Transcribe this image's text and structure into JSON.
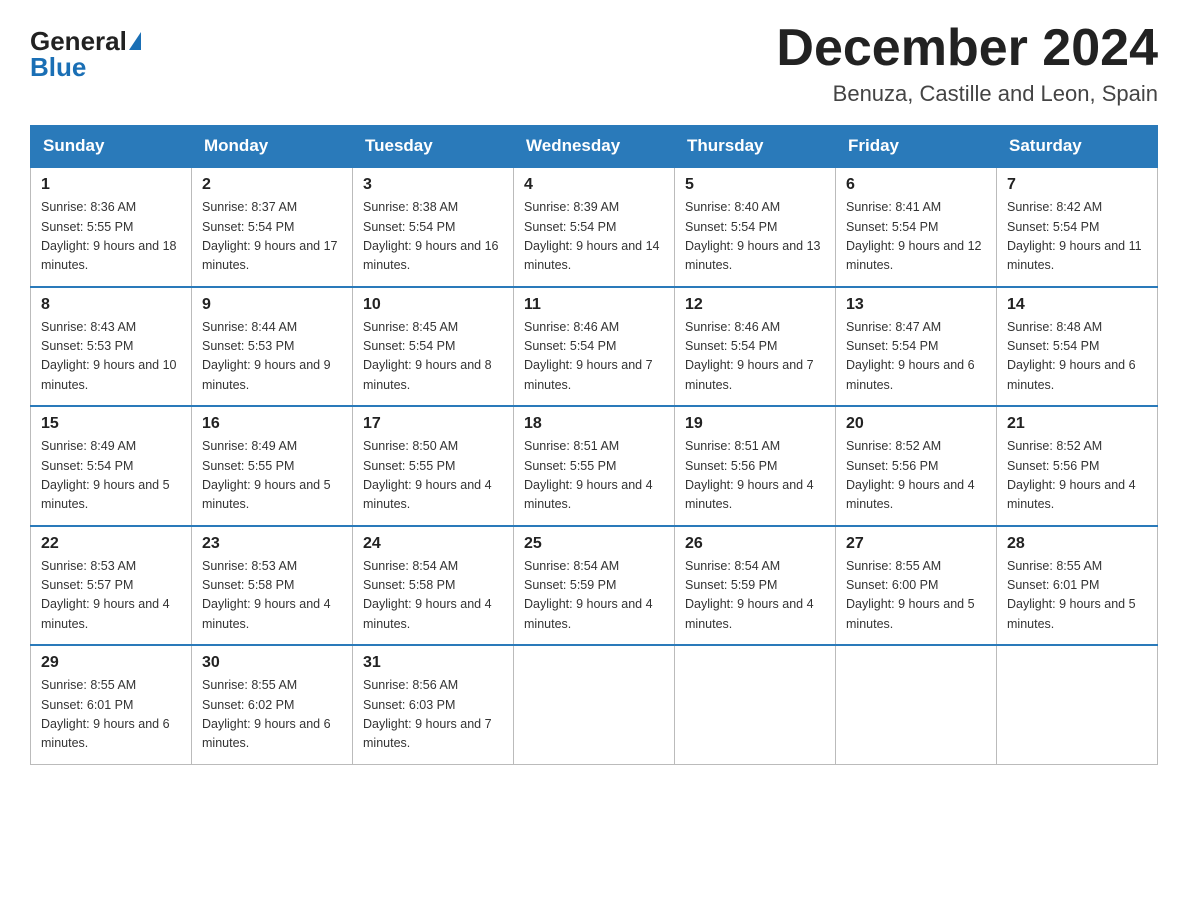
{
  "header": {
    "logo_general": "General",
    "logo_blue": "Blue",
    "title": "December 2024",
    "location": "Benuza, Castille and Leon, Spain"
  },
  "weekdays": [
    "Sunday",
    "Monday",
    "Tuesday",
    "Wednesday",
    "Thursday",
    "Friday",
    "Saturday"
  ],
  "weeks": [
    [
      {
        "day": "1",
        "sunrise": "8:36 AM",
        "sunset": "5:55 PM",
        "daylight": "9 hours and 18 minutes."
      },
      {
        "day": "2",
        "sunrise": "8:37 AM",
        "sunset": "5:54 PM",
        "daylight": "9 hours and 17 minutes."
      },
      {
        "day": "3",
        "sunrise": "8:38 AM",
        "sunset": "5:54 PM",
        "daylight": "9 hours and 16 minutes."
      },
      {
        "day": "4",
        "sunrise": "8:39 AM",
        "sunset": "5:54 PM",
        "daylight": "9 hours and 14 minutes."
      },
      {
        "day": "5",
        "sunrise": "8:40 AM",
        "sunset": "5:54 PM",
        "daylight": "9 hours and 13 minutes."
      },
      {
        "day": "6",
        "sunrise": "8:41 AM",
        "sunset": "5:54 PM",
        "daylight": "9 hours and 12 minutes."
      },
      {
        "day": "7",
        "sunrise": "8:42 AM",
        "sunset": "5:54 PM",
        "daylight": "9 hours and 11 minutes."
      }
    ],
    [
      {
        "day": "8",
        "sunrise": "8:43 AM",
        "sunset": "5:53 PM",
        "daylight": "9 hours and 10 minutes."
      },
      {
        "day": "9",
        "sunrise": "8:44 AM",
        "sunset": "5:53 PM",
        "daylight": "9 hours and 9 minutes."
      },
      {
        "day": "10",
        "sunrise": "8:45 AM",
        "sunset": "5:54 PM",
        "daylight": "9 hours and 8 minutes."
      },
      {
        "day": "11",
        "sunrise": "8:46 AM",
        "sunset": "5:54 PM",
        "daylight": "9 hours and 7 minutes."
      },
      {
        "day": "12",
        "sunrise": "8:46 AM",
        "sunset": "5:54 PM",
        "daylight": "9 hours and 7 minutes."
      },
      {
        "day": "13",
        "sunrise": "8:47 AM",
        "sunset": "5:54 PM",
        "daylight": "9 hours and 6 minutes."
      },
      {
        "day": "14",
        "sunrise": "8:48 AM",
        "sunset": "5:54 PM",
        "daylight": "9 hours and 6 minutes."
      }
    ],
    [
      {
        "day": "15",
        "sunrise": "8:49 AM",
        "sunset": "5:54 PM",
        "daylight": "9 hours and 5 minutes."
      },
      {
        "day": "16",
        "sunrise": "8:49 AM",
        "sunset": "5:55 PM",
        "daylight": "9 hours and 5 minutes."
      },
      {
        "day": "17",
        "sunrise": "8:50 AM",
        "sunset": "5:55 PM",
        "daylight": "9 hours and 4 minutes."
      },
      {
        "day": "18",
        "sunrise": "8:51 AM",
        "sunset": "5:55 PM",
        "daylight": "9 hours and 4 minutes."
      },
      {
        "day": "19",
        "sunrise": "8:51 AM",
        "sunset": "5:56 PM",
        "daylight": "9 hours and 4 minutes."
      },
      {
        "day": "20",
        "sunrise": "8:52 AM",
        "sunset": "5:56 PM",
        "daylight": "9 hours and 4 minutes."
      },
      {
        "day": "21",
        "sunrise": "8:52 AM",
        "sunset": "5:56 PM",
        "daylight": "9 hours and 4 minutes."
      }
    ],
    [
      {
        "day": "22",
        "sunrise": "8:53 AM",
        "sunset": "5:57 PM",
        "daylight": "9 hours and 4 minutes."
      },
      {
        "day": "23",
        "sunrise": "8:53 AM",
        "sunset": "5:58 PM",
        "daylight": "9 hours and 4 minutes."
      },
      {
        "day": "24",
        "sunrise": "8:54 AM",
        "sunset": "5:58 PM",
        "daylight": "9 hours and 4 minutes."
      },
      {
        "day": "25",
        "sunrise": "8:54 AM",
        "sunset": "5:59 PM",
        "daylight": "9 hours and 4 minutes."
      },
      {
        "day": "26",
        "sunrise": "8:54 AM",
        "sunset": "5:59 PM",
        "daylight": "9 hours and 4 minutes."
      },
      {
        "day": "27",
        "sunrise": "8:55 AM",
        "sunset": "6:00 PM",
        "daylight": "9 hours and 5 minutes."
      },
      {
        "day": "28",
        "sunrise": "8:55 AM",
        "sunset": "6:01 PM",
        "daylight": "9 hours and 5 minutes."
      }
    ],
    [
      {
        "day": "29",
        "sunrise": "8:55 AM",
        "sunset": "6:01 PM",
        "daylight": "9 hours and 6 minutes."
      },
      {
        "day": "30",
        "sunrise": "8:55 AM",
        "sunset": "6:02 PM",
        "daylight": "9 hours and 6 minutes."
      },
      {
        "day": "31",
        "sunrise": "8:56 AM",
        "sunset": "6:03 PM",
        "daylight": "9 hours and 7 minutes."
      },
      null,
      null,
      null,
      null
    ]
  ]
}
